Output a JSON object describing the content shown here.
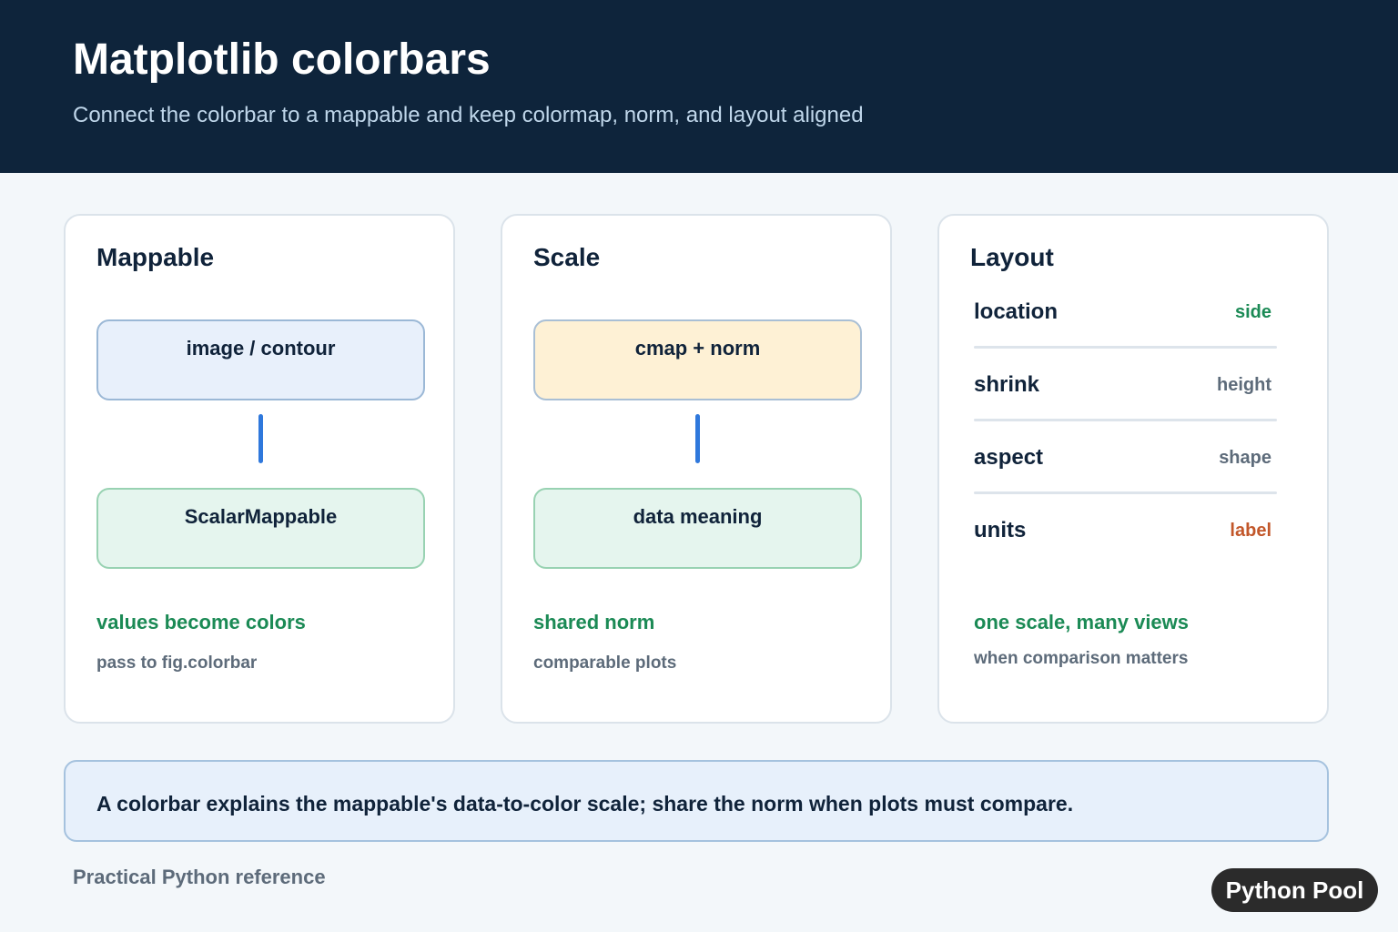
{
  "header": {
    "title": "Matplotlib colorbars",
    "subtitle": "Connect the colorbar to a mappable and keep colormap, norm, and layout aligned"
  },
  "cards": {
    "mappable": {
      "title": "Mappable",
      "top_box": "image / contour",
      "bottom_box": "ScalarMappable",
      "note_highlight": "values become colors",
      "note_detail": "pass to fig.colorbar"
    },
    "scale": {
      "title": "Scale",
      "top_box": "cmap + norm",
      "bottom_box": "data meaning",
      "note_highlight": "shared norm",
      "note_detail": "comparable plots"
    },
    "layout": {
      "title": "Layout",
      "rows": [
        {
          "key": "location",
          "value": "side"
        },
        {
          "key": "shrink",
          "value": "height"
        },
        {
          "key": "aspect",
          "value": "shape"
        },
        {
          "key": "units",
          "value": "label"
        }
      ],
      "note_highlight": "one scale, many views",
      "note_detail": "when comparison matters"
    }
  },
  "callout": {
    "text": "A colorbar explains the mappable's data-to-color scale; share the norm when plots must compare."
  },
  "footer": {
    "text": "Practical Python reference",
    "brand": "Python Pool"
  },
  "colors": {
    "header_bg": "#0e243b",
    "connector": "#2f78dc",
    "highlight_green": "#1b8a55",
    "accent_orange": "#c2572a"
  }
}
